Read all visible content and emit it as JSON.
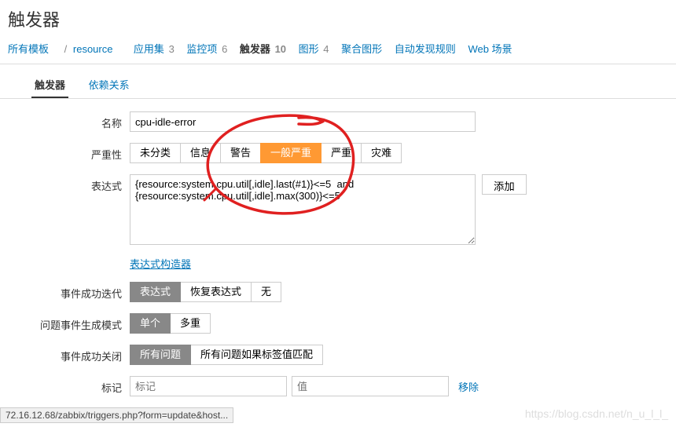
{
  "page_title": "触发器",
  "breadcrumb": {
    "root": "所有模板",
    "current": "resource"
  },
  "nav": [
    {
      "label": "应用集",
      "count": "3"
    },
    {
      "label": "监控项",
      "count": "6"
    },
    {
      "label": "触发器",
      "count": "10",
      "active": true
    },
    {
      "label": "图形",
      "count": "4"
    },
    {
      "label": "聚合图形",
      "count": ""
    },
    {
      "label": "自动发现规则",
      "count": ""
    },
    {
      "label": "Web 场景",
      "count": ""
    }
  ],
  "subtabs": {
    "trigger": "触发器",
    "deps": "依赖关系"
  },
  "labels": {
    "name": "名称",
    "severity": "严重性",
    "expression": "表达式",
    "expr_builder": "表达式构造器",
    "ok_event": "事件成功迭代",
    "problem_mode": "问题事件生成模式",
    "ok_close": "事件成功关闭",
    "tags": "标记",
    "add": "添加",
    "remove": "移除"
  },
  "values": {
    "name": "cpu-idle-error",
    "expression": "{resource:system.cpu.util[,idle].last(#1)}<=5  and\n{resource:system.cpu.util[,idle].max(300)}<=5",
    "tag_name_placeholder": "标记",
    "tag_value_placeholder": "值"
  },
  "severity": [
    "未分类",
    "信息",
    "警告",
    "一般严重",
    "严重",
    "灾难"
  ],
  "severity_active": 3,
  "ok_event": [
    "表达式",
    "恢复表达式",
    "无"
  ],
  "ok_event_active": 0,
  "problem_mode": [
    "单个",
    "多重"
  ],
  "problem_mode_active": 0,
  "ok_close": [
    "所有问题",
    "所有问题如果标签值匹配"
  ],
  "ok_close_active": 0,
  "footer_url": "72.16.12.68/zabbix/triggers.php?form=update&host...",
  "watermark": "https://blog.csdn.net/n_u_l_l_"
}
